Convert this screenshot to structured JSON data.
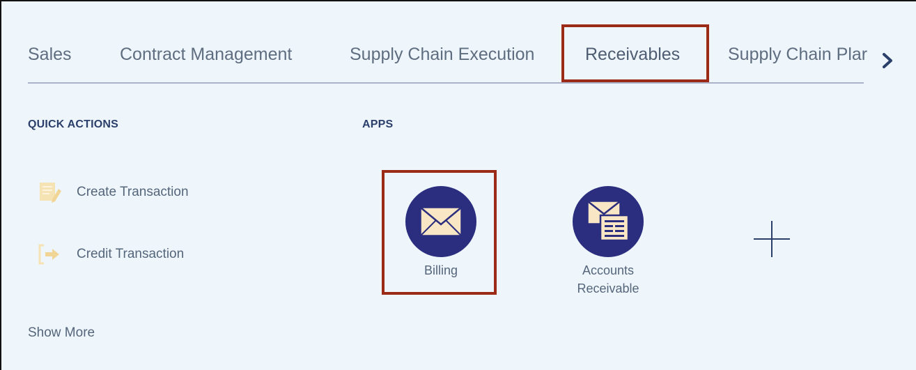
{
  "tabs": [
    {
      "label": "Sales"
    },
    {
      "label": "Contract Management"
    },
    {
      "label": "Supply Chain Execution"
    },
    {
      "label": "Receivables"
    },
    {
      "label": "Supply Chain Plar"
    }
  ],
  "selected_tab": "Receivables",
  "quick_actions": {
    "title": "QUICK ACTIONS",
    "items": [
      {
        "label": "Create Transaction",
        "icon": "create-transaction-icon"
      },
      {
        "label": "Credit Transaction",
        "icon": "credit-transaction-icon"
      }
    ],
    "show_more": "Show More"
  },
  "apps": {
    "title": "APPS",
    "items": [
      {
        "label": "Billing",
        "icon": "billing-envelope-icon"
      },
      {
        "label": "Accounts Receivable",
        "label_line1": "Accounts",
        "label_line2": "Receivable",
        "icon": "accounts-receivable-icon"
      }
    ],
    "add_icon": "plus-icon"
  },
  "colors": {
    "background": "#eef6fc",
    "highlight": "#9b2a17",
    "app_circle": "#2b2e7e",
    "envelope": "#f9e6c4",
    "quick_action_icon": "#f6e3b4",
    "section_title": "#2b3f6b"
  }
}
